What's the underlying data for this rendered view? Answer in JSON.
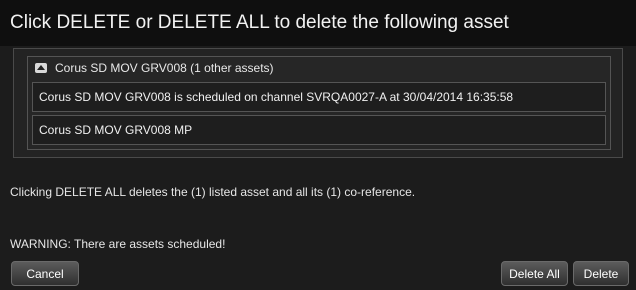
{
  "dialog": {
    "title": "Click DELETE or DELETE ALL to delete the following asset"
  },
  "asset_group": {
    "header": "Corus SD MOV GRV008  (1 other assets)",
    "icon": "collapse-up-icon",
    "rows": [
      "Corus SD MOV GRV008 is scheduled on channel SVRQA0027-A at 30/04/2014 16:35:58",
      "Corus SD MOV GRV008 MP"
    ]
  },
  "messages": {
    "info": "Clicking DELETE ALL deletes the (1) listed asset and all its (1) co-reference.",
    "warning": "WARNING: There are assets scheduled!"
  },
  "buttons": {
    "cancel": "Cancel",
    "delete_all": "Delete All",
    "delete": "Delete"
  }
}
